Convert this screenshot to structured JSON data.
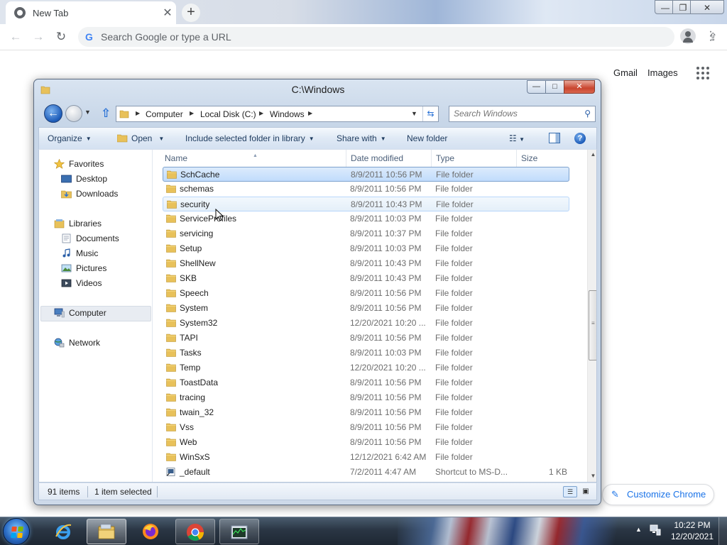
{
  "browser": {
    "tab_title": "New Tab",
    "tab_close": "✕",
    "new_tab": "+",
    "omnibox_placeholder": "Search Google or type a URL",
    "window_controls": {
      "minimize": "—",
      "maximize": "❐",
      "close": "✕"
    }
  },
  "ntp": {
    "gmail": "Gmail",
    "images": "Images",
    "customize": "Customize Chrome"
  },
  "explorer": {
    "title": "C:\\Windows",
    "window_controls": {
      "minimize": "—",
      "maximize": "□",
      "close": "✕"
    },
    "breadcrumb": [
      "Computer",
      "Local Disk (C:)",
      "Windows"
    ],
    "search_placeholder": "Search Windows",
    "commands": {
      "organize": "Organize",
      "open": "Open",
      "include": "Include selected folder in library",
      "share": "Share with",
      "new_folder": "New folder"
    },
    "nav": {
      "favorites": "Favorites",
      "desktop": "Desktop",
      "downloads": "Downloads",
      "libraries": "Libraries",
      "documents": "Documents",
      "music": "Music",
      "pictures": "Pictures",
      "videos": "Videos",
      "computer": "Computer",
      "network": "Network"
    },
    "columns": {
      "name": "Name",
      "date": "Date modified",
      "type": "Type",
      "size": "Size"
    },
    "files": [
      {
        "name": "SchCache",
        "date": "8/9/2011 10:56 PM",
        "type": "File folder",
        "size": "",
        "state": "selected"
      },
      {
        "name": "schemas",
        "date": "8/9/2011 10:56 PM",
        "type": "File folder",
        "size": "",
        "state": ""
      },
      {
        "name": "security",
        "date": "8/9/2011 10:43 PM",
        "type": "File folder",
        "size": "",
        "state": "hover"
      },
      {
        "name": "ServiceProfiles",
        "date": "8/9/2011 10:03 PM",
        "type": "File folder",
        "size": "",
        "state": ""
      },
      {
        "name": "servicing",
        "date": "8/9/2011 10:37 PM",
        "type": "File folder",
        "size": "",
        "state": ""
      },
      {
        "name": "Setup",
        "date": "8/9/2011 10:03 PM",
        "type": "File folder",
        "size": "",
        "state": ""
      },
      {
        "name": "ShellNew",
        "date": "8/9/2011 10:43 PM",
        "type": "File folder",
        "size": "",
        "state": ""
      },
      {
        "name": "SKB",
        "date": "8/9/2011 10:43 PM",
        "type": "File folder",
        "size": "",
        "state": ""
      },
      {
        "name": "Speech",
        "date": "8/9/2011 10:56 PM",
        "type": "File folder",
        "size": "",
        "state": ""
      },
      {
        "name": "System",
        "date": "8/9/2011 10:56 PM",
        "type": "File folder",
        "size": "",
        "state": ""
      },
      {
        "name": "System32",
        "date": "12/20/2021 10:20 ...",
        "type": "File folder",
        "size": "",
        "state": ""
      },
      {
        "name": "TAPI",
        "date": "8/9/2011 10:56 PM",
        "type": "File folder",
        "size": "",
        "state": ""
      },
      {
        "name": "Tasks",
        "date": "8/9/2011 10:03 PM",
        "type": "File folder",
        "size": "",
        "state": ""
      },
      {
        "name": "Temp",
        "date": "12/20/2021 10:20 ...",
        "type": "File folder",
        "size": "",
        "state": ""
      },
      {
        "name": "ToastData",
        "date": "8/9/2011 10:56 PM",
        "type": "File folder",
        "size": "",
        "state": ""
      },
      {
        "name": "tracing",
        "date": "8/9/2011 10:56 PM",
        "type": "File folder",
        "size": "",
        "state": ""
      },
      {
        "name": "twain_32",
        "date": "8/9/2011 10:56 PM",
        "type": "File folder",
        "size": "",
        "state": ""
      },
      {
        "name": "Vss",
        "date": "8/9/2011 10:56 PM",
        "type": "File folder",
        "size": "",
        "state": ""
      },
      {
        "name": "Web",
        "date": "8/9/2011 10:56 PM",
        "type": "File folder",
        "size": "",
        "state": ""
      },
      {
        "name": "WinSxS",
        "date": "12/12/2021 6:42 AM",
        "type": "File folder",
        "size": "",
        "state": ""
      },
      {
        "name": "_default",
        "date": "7/2/2011 4:47 AM",
        "type": "Shortcut to MS-D...",
        "size": "1 KB",
        "state": "",
        "icon": "shortcut"
      }
    ],
    "status": {
      "items": "91 items",
      "selected": "1 item selected"
    }
  },
  "taskbar": {
    "apps": [
      {
        "name": "internet-explorer",
        "state": "pinned"
      },
      {
        "name": "windows-explorer",
        "state": "active"
      },
      {
        "name": "firefox",
        "state": "pinned"
      },
      {
        "name": "chrome",
        "state": "pinned-open"
      },
      {
        "name": "task-manager",
        "state": "pinned-open"
      }
    ],
    "time": "10:22 PM",
    "date": "12/20/2021"
  },
  "colors": {
    "chrome_accent": "#1a73e8",
    "selection": "#c1dcfc",
    "folder": "#e8c15a"
  }
}
